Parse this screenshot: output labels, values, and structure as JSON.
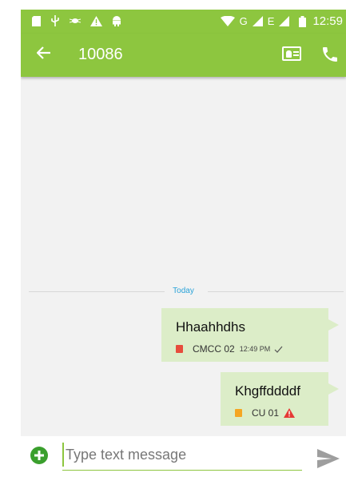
{
  "status_bar": {
    "left_icons": [
      "sd-card-icon",
      "usb-icon",
      "bug-icon",
      "warning-icon",
      "android-icon"
    ],
    "right_icons": [
      "wifi-icon",
      "signal-icon",
      "battery-icon"
    ],
    "network_label_1": "G",
    "network_label_2": "E",
    "time": "12:59"
  },
  "app_bar": {
    "title": "10086",
    "back_icon": "arrow-left-icon",
    "contact_icon": "contact-card-icon",
    "call_icon": "phone-icon",
    "color": "#8dc63f"
  },
  "conversation": {
    "date_divider": "Today",
    "messages": [
      {
        "text": "Hhaahhdhs",
        "sim": "CMCC 02",
        "time": "12:49 PM",
        "status": "delivered",
        "sim_color": "#e74c3c"
      },
      {
        "text": "Khgffddddf",
        "sim": "CU 01",
        "time": "",
        "status": "failed",
        "sim_color": "#f5a623"
      }
    ]
  },
  "composer": {
    "placeholder": "Type text message",
    "value": "",
    "add_icon": "plus-circle-icon",
    "send_icon": "send-icon"
  }
}
